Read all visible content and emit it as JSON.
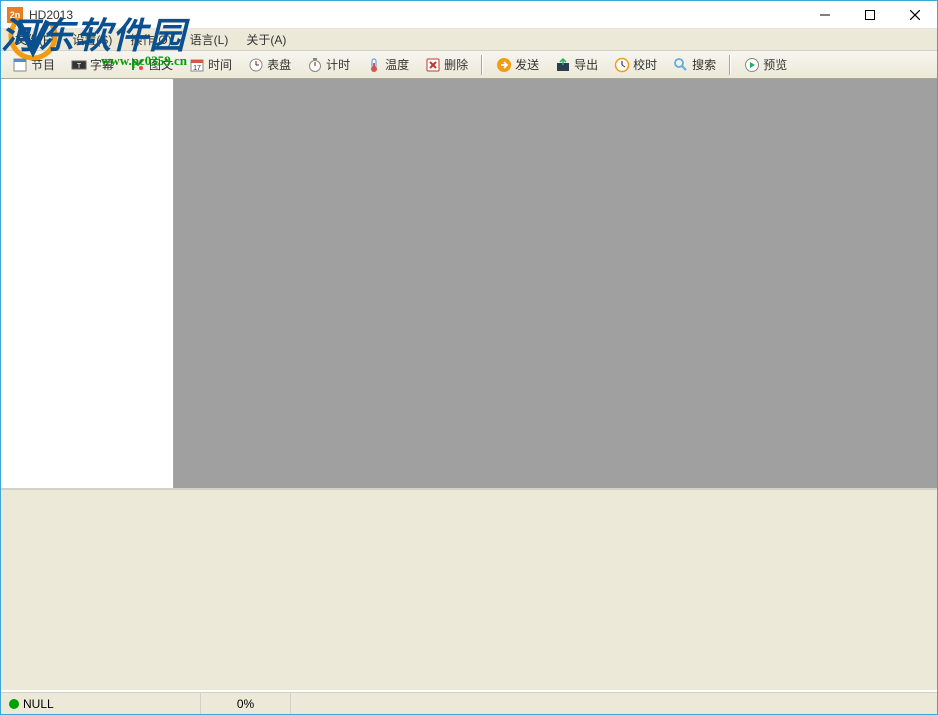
{
  "window": {
    "title": "HD2013",
    "icon_text": "2n"
  },
  "menu": {
    "items": [
      {
        "label": "文件(F)"
      },
      {
        "label": "设置(S)"
      },
      {
        "label": "操作(O)"
      },
      {
        "label": "语言(L)"
      },
      {
        "label": "关于(A)"
      }
    ]
  },
  "toolbar": {
    "group1": [
      {
        "name": "program-button",
        "label": "节目",
        "icon": "program"
      },
      {
        "name": "subtitle-button",
        "label": "字幕",
        "icon": "subtitle"
      },
      {
        "name": "graphic-button",
        "label": "图文",
        "icon": "graphic"
      },
      {
        "name": "time-button",
        "label": "时间",
        "icon": "time"
      },
      {
        "name": "dial-button",
        "label": "表盘",
        "icon": "dial"
      },
      {
        "name": "timer-button",
        "label": "计时",
        "icon": "timer"
      },
      {
        "name": "temperature-button",
        "label": "温度",
        "icon": "temperature"
      },
      {
        "name": "delete-button",
        "label": "删除",
        "icon": "delete"
      }
    ],
    "group2": [
      {
        "name": "send-button",
        "label": "发送",
        "icon": "send"
      },
      {
        "name": "export-button",
        "label": "导出",
        "icon": "export"
      },
      {
        "name": "calibrate-button",
        "label": "校时",
        "icon": "calibrate"
      },
      {
        "name": "search-button",
        "label": "搜索",
        "icon": "search"
      }
    ],
    "group3": [
      {
        "name": "preview-button",
        "label": "预览",
        "icon": "preview"
      }
    ]
  },
  "status": {
    "connection": "NULL",
    "progress": "0%"
  },
  "watermark": {
    "text": "河东软件园",
    "url": "www.pc0359.cn"
  }
}
